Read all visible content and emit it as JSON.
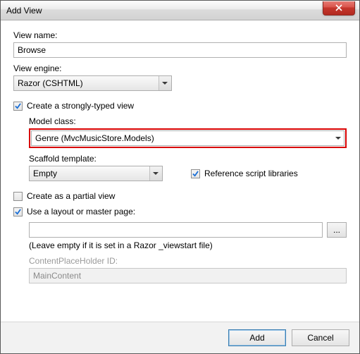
{
  "window": {
    "title": "Add View"
  },
  "viewName": {
    "label": "View name:",
    "value": "Browse"
  },
  "viewEngine": {
    "label": "View engine:",
    "value": "Razor (CSHTML)"
  },
  "stronglyTyped": {
    "label": "Create a strongly-typed view",
    "checked": true,
    "modelClass": {
      "label": "Model class:",
      "value": "Genre (MvcMusicStore.Models)"
    },
    "scaffold": {
      "label": "Scaffold template:",
      "value": "Empty"
    },
    "refScripts": {
      "label": "Reference script libraries",
      "checked": true
    }
  },
  "partialView": {
    "label": "Create as a partial view",
    "checked": false
  },
  "useLayout": {
    "label": "Use a layout or master page:",
    "checked": true,
    "path": "",
    "browse": "...",
    "hint": "(Leave empty if it is set in a Razor _viewstart file)",
    "cph": {
      "label": "ContentPlaceHolder ID:",
      "value": "MainContent"
    }
  },
  "buttons": {
    "add": "Add",
    "cancel": "Cancel"
  }
}
